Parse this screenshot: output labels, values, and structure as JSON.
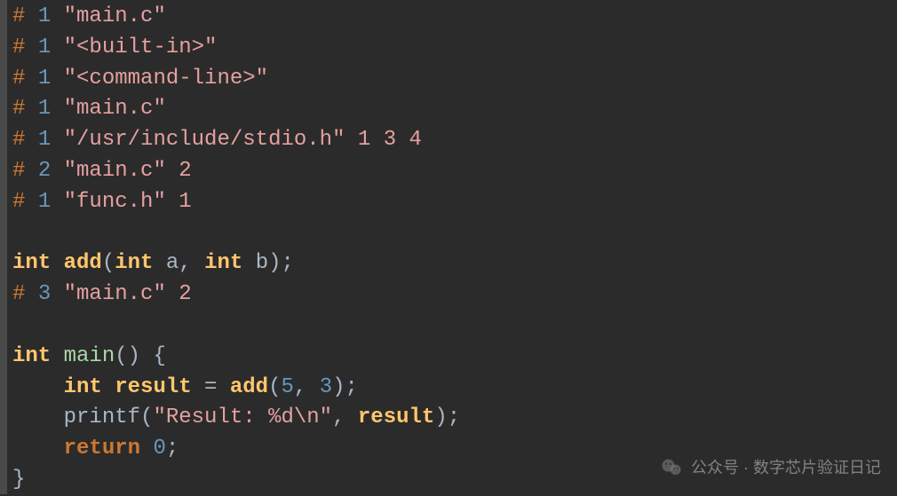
{
  "code": {
    "lines": [
      {
        "type": "preproc",
        "hash": "#",
        "num": "1",
        "str": "\"main.c\"",
        "flags": ""
      },
      {
        "type": "preproc",
        "hash": "#",
        "num": "1",
        "str": "\"<built-in>\"",
        "flags": ""
      },
      {
        "type": "preproc",
        "hash": "#",
        "num": "1",
        "str": "\"<command-line>\"",
        "flags": ""
      },
      {
        "type": "preproc",
        "hash": "#",
        "num": "1",
        "str": "\"main.c\"",
        "flags": ""
      },
      {
        "type": "preproc",
        "hash": "#",
        "num": "1",
        "str": "\"/usr/include/stdio.h\"",
        "flags": " 1 3 4"
      },
      {
        "type": "preproc",
        "hash": "#",
        "num": "2",
        "str": "\"main.c\"",
        "flags": " 2"
      },
      {
        "type": "preproc",
        "hash": "#",
        "num": "1",
        "str": "\"func.h\"",
        "flags": " 1"
      },
      {
        "type": "blank"
      },
      {
        "type": "decl",
        "ret": "int",
        "name": "add",
        "params": [
          {
            "type": "int",
            "name": "a"
          },
          {
            "type": "int",
            "name": "b"
          }
        ],
        "terminator": ";"
      },
      {
        "type": "preproc",
        "hash": "#",
        "num": "3",
        "str": "\"main.c\"",
        "flags": " 2"
      },
      {
        "type": "blank"
      },
      {
        "type": "funcdef",
        "ret": "int",
        "name": "main",
        "open": "() {"
      },
      {
        "type": "stmt_assign",
        "indent": "    ",
        "vartype": "int",
        "varname": "result",
        "op": " = ",
        "call": "add",
        "args": [
          "5",
          "3"
        ],
        "end": ";"
      },
      {
        "type": "stmt_call",
        "indent": "    ",
        "call": "printf",
        "strarg": "\"Result: %d\\n\"",
        "argsep": ", ",
        "arg2": "result",
        "end": ";"
      },
      {
        "type": "stmt_return",
        "indent": "    ",
        "kw": "return",
        "val": "0",
        "end": ";"
      },
      {
        "type": "close",
        "brace": "}"
      }
    ]
  },
  "watermark": {
    "text": "公众号 · 数字芯片验证日记"
  }
}
